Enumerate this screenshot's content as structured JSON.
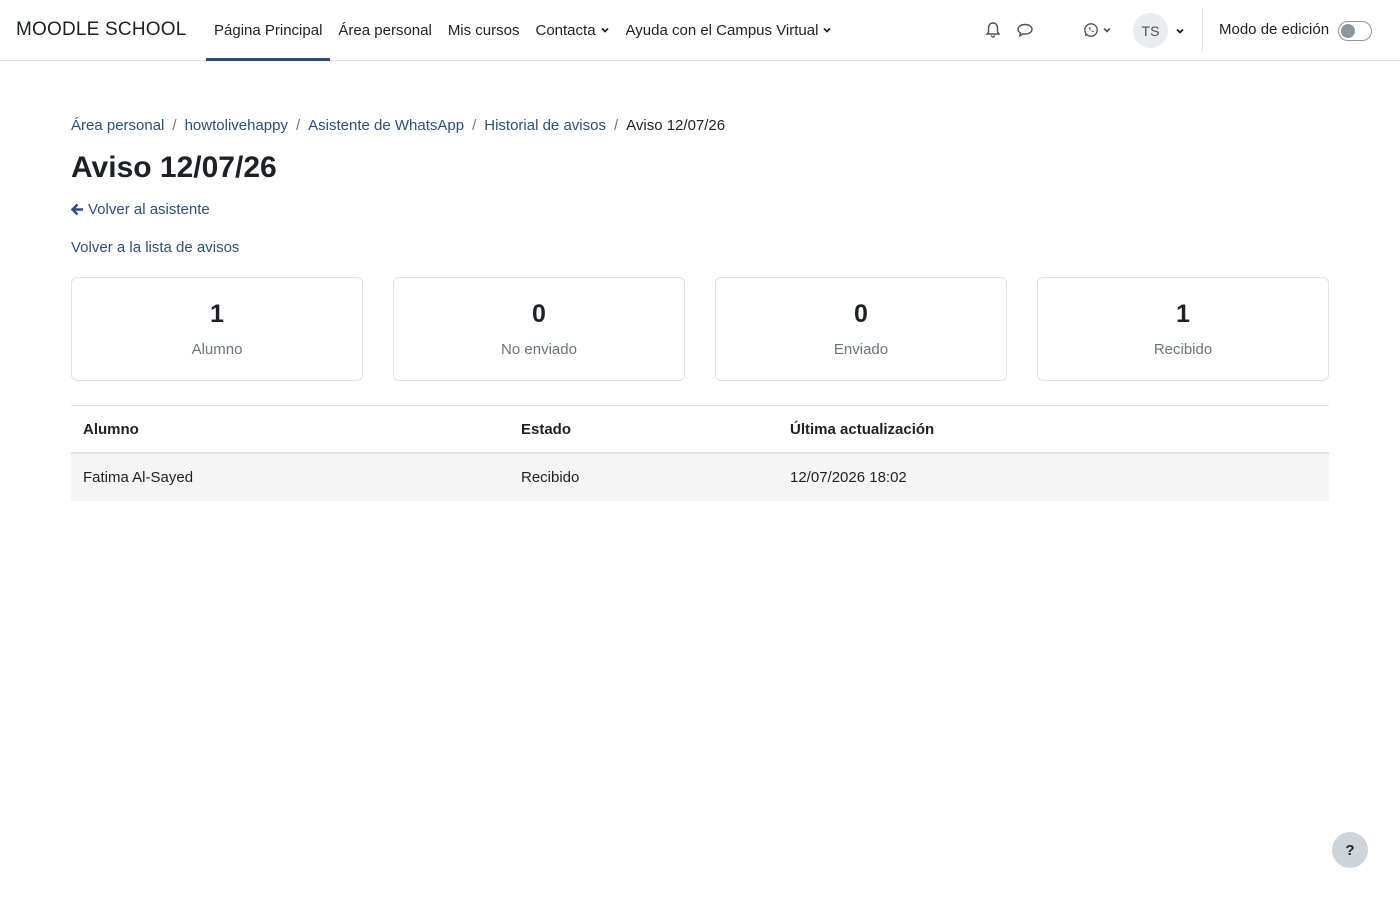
{
  "navbar": {
    "brand": "MOODLE SCHOOL",
    "items": [
      {
        "label": "Página Principal",
        "active": true
      },
      {
        "label": "Área personal"
      },
      {
        "label": "Mis cursos"
      },
      {
        "label": "Contacta",
        "dropdown": true
      },
      {
        "label": "Ayuda con el Campus Virtual",
        "dropdown": true
      }
    ],
    "icons": [
      "bell-icon",
      "chat-bubble-icon",
      "whatsapp-icon"
    ],
    "user_initials": "TS",
    "edit_mode_label": "Modo de edición",
    "edit_mode_on": false
  },
  "breadcrumb": {
    "items": [
      "Área personal",
      "howtolivehappy",
      "Asistente de WhatsApp",
      "Historial de avisos"
    ],
    "current": "Aviso 12/07/26"
  },
  "page": {
    "title": "Aviso 12/07/26",
    "back_link": "Volver al asistente",
    "list_link": "Volver a la lista de avisos"
  },
  "stats": [
    {
      "value": "1",
      "label": "Alumno"
    },
    {
      "value": "0",
      "label": "No enviado"
    },
    {
      "value": "0",
      "label": "Enviado"
    },
    {
      "value": "1",
      "label": "Recibido"
    }
  ],
  "table": {
    "headers": [
      "Alumno",
      "Estado",
      "Última actualización"
    ],
    "rows": [
      [
        "Fatima Al-Sayed",
        "Recibido",
        "12/07/2026 18:02"
      ]
    ]
  },
  "help_button": "?",
  "colors": {
    "link": "#2c4f7c",
    "active_underline": "#2e4a7a",
    "row_bg": "#f5f5f5"
  }
}
